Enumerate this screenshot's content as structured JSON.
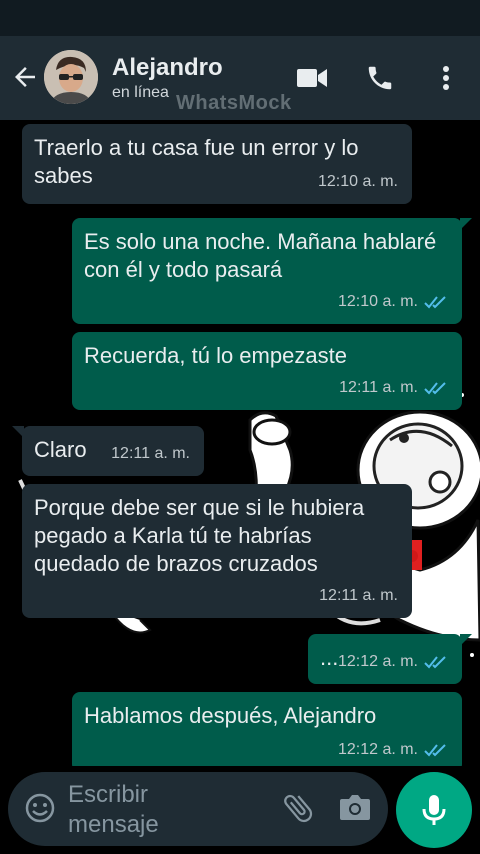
{
  "header": {
    "contact_name": "Alejandro",
    "contact_status": "en línea",
    "watermark": "WhatsMock",
    "icons": [
      "back-arrow-icon",
      "video-call-icon",
      "phone-icon",
      "more-vert-icon"
    ]
  },
  "messages": [
    {
      "direction": "in",
      "text": "Traerlo a tu casa fue un error y lo sabes",
      "time": "12:10 a. m."
    },
    {
      "direction": "out",
      "text": "Es solo una noche. Mañana hablaré con él y todo pasará",
      "time": "12:10 a. m.",
      "read": true
    },
    {
      "direction": "out",
      "text": "Recuerda, tú lo empezaste",
      "time": "12:11 a. m.",
      "read": true
    },
    {
      "direction": "in",
      "text": "Claro",
      "time": "12:11 a. m."
    },
    {
      "direction": "in",
      "text": "Porque debe ser que si le hubiera pegado a Karla tú te habrías quedado de brazos cruzados",
      "time": "12:11 a. m."
    },
    {
      "direction": "out",
      "text": "...",
      "time": "12:12 a. m.",
      "read": true
    },
    {
      "direction": "out",
      "text": "Hablamos después, Alejandro",
      "time": "12:12 a. m.",
      "read": true
    }
  ],
  "input": {
    "placeholder": "Escribir mensaje"
  },
  "colors": {
    "header_bg": "#1f2c34",
    "incoming_bubble": "#1f2c34",
    "outgoing_bubble": "#005c4b",
    "read_ticks": "#53bdeb",
    "mic_button": "#00a884",
    "chat_bg": "#000000"
  }
}
